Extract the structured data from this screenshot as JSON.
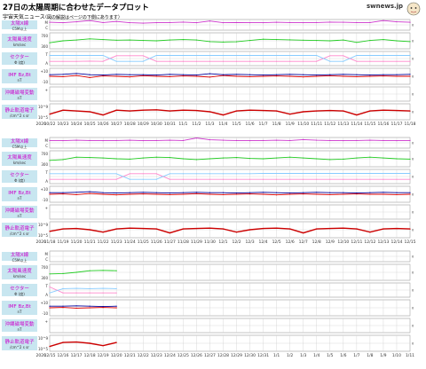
{
  "header": {
    "title": "27日の太陽周期に合わせたデータプロット",
    "subtitle": "宇宙天気ニュース",
    "note": "（図の解説はページの下側にあります）",
    "logo_text": "swnews.jp"
  },
  "colors": {
    "panel_bg": "#c8e6f0",
    "label_text": "#cc00cc",
    "grid": "#cfcfcf",
    "xray": "#cc33cc",
    "wind": "#22cc22",
    "sector_pink": "#ff88cc",
    "sector_blue": "#88ccff",
    "imf_bz": "#dd0000",
    "imf_bt": "#000099",
    "electron": "#cc0000"
  },
  "chart_data": [
    {
      "type": "line",
      "year_label": "2020",
      "x": [
        "10/22",
        "10/23",
        "10/24",
        "10/25",
        "10/26",
        "10/27",
        "10/28",
        "10/29",
        "10/30",
        "10/31",
        "11/1",
        "11/2",
        "11/3",
        "11/4",
        "11/5",
        "11/6",
        "11/7",
        "11/8",
        "11/9",
        "11/10",
        "11/11",
        "11/12",
        "11/13",
        "11/14",
        "11/15",
        "11/16",
        "11/17",
        "11/18"
      ],
      "panels": [
        {
          "label": "太陽X線",
          "sub": "C5M以上",
          "scale": [
            "M",
            "C"
          ],
          "series": [
            {
              "color_key": "xray",
              "values": [
                0.74,
                0.7,
                0.78,
                0.9,
                0.72,
                0.82,
                0.7,
                0.66,
                0.7,
                0.72,
                0.76,
                0.7,
                0.86,
                0.7,
                0.72,
                0.7,
                0.7,
                0.74,
                0.72,
                0.7,
                0.72,
                0.76,
                0.74,
                0.72,
                0.72,
                0.9,
                0.78,
                0.74
              ]
            }
          ]
        },
        {
          "label": "太陽風速度",
          "sub": "km/sec",
          "scale": [
            "700",
            "300"
          ],
          "series": [
            {
              "color_key": "wind",
              "values": [
                0.38,
                0.5,
                0.55,
                0.62,
                0.58,
                0.54,
                0.55,
                0.52,
                0.5,
                0.55,
                0.58,
                0.55,
                0.45,
                0.42,
                0.44,
                0.52,
                0.6,
                0.58,
                0.56,
                0.54,
                0.52,
                0.5,
                0.55,
                0.4,
                0.52,
                0.58,
                0.5,
                0.45
              ]
            }
          ]
        },
        {
          "label": "セクター",
          "sub": "Φ (度)",
          "scale": [
            "T",
            "A"
          ],
          "series": [
            {
              "color_key": "sector_pink",
              "values": [
                0.3,
                0.3,
                0.3,
                0.32,
                0.3,
                0.7,
                0.7,
                0.7,
                0.3,
                0.3,
                0.3,
                0.3,
                0.3,
                0.3,
                0.3,
                0.3,
                0.3,
                0.3,
                0.3,
                0.3,
                0.3,
                0.7,
                0.7,
                0.3,
                0.3,
                0.3,
                0.3,
                0.3
              ]
            },
            {
              "color_key": "sector_blue",
              "values": [
                0.72,
                0.72,
                0.72,
                0.72,
                0.72,
                0.3,
                0.3,
                0.3,
                0.72,
                0.72,
                0.72,
                0.72,
                0.72,
                0.72,
                0.72,
                0.72,
                0.72,
                0.72,
                0.72,
                0.72,
                0.72,
                0.3,
                0.3,
                0.72,
                0.72,
                0.72,
                0.72,
                0.72
              ]
            }
          ]
        },
        {
          "label": "IMF Bz,Bt",
          "sub": "nT",
          "scale": [
            "+10",
            "-10"
          ],
          "series": [
            {
              "color_key": "imf_bz",
              "values": [
                0.5,
                0.48,
                0.55,
                0.42,
                0.52,
                0.5,
                0.46,
                0.54,
                0.5,
                0.48,
                0.52,
                0.5,
                0.45,
                0.55,
                0.5,
                0.48,
                0.5,
                0.52,
                0.5,
                0.46,
                0.5,
                0.54,
                0.5,
                0.48,
                0.5,
                0.52,
                0.5,
                0.5
              ]
            },
            {
              "color_key": "imf_bt",
              "values": [
                0.6,
                0.62,
                0.68,
                0.6,
                0.58,
                0.62,
                0.6,
                0.6,
                0.58,
                0.62,
                0.6,
                0.58,
                0.66,
                0.6,
                0.62,
                0.6,
                0.58,
                0.6,
                0.62,
                0.6,
                0.58,
                0.6,
                0.62,
                0.6,
                0.58,
                0.6,
                0.6,
                0.62
              ]
            }
          ]
        },
        {
          "label": "沖縄磁場変動",
          "sub": "nT",
          "scale": [
            "+",
            ""
          ],
          "series": []
        },
        {
          "label": "静止軌道電子",
          "sub": "/cm^2 s sr",
          "scale": [
            "10^9",
            "10^5"
          ],
          "series": [
            {
              "color_key": "electron",
              "values": [
                0.35,
                0.6,
                0.55,
                0.5,
                0.3,
                0.6,
                0.55,
                0.6,
                0.62,
                0.55,
                0.6,
                0.58,
                0.5,
                0.3,
                0.55,
                0.6,
                0.58,
                0.55,
                0.35,
                0.5,
                0.55,
                0.58,
                0.55,
                0.3,
                0.55,
                0.6,
                0.58,
                0.55
              ]
            }
          ]
        }
      ]
    },
    {
      "type": "line",
      "year_label": "2020",
      "x": [
        "11/18",
        "11/19",
        "11/20",
        "11/21",
        "11/22",
        "11/23",
        "11/24",
        "11/25",
        "11/26",
        "11/27",
        "11/28",
        "11/29",
        "11/30",
        "12/1",
        "12/2",
        "12/3",
        "12/4",
        "12/5",
        "12/6",
        "12/7",
        "12/8",
        "12/9",
        "12/10",
        "12/11",
        "12/12",
        "12/13",
        "12/14",
        "12/15"
      ],
      "panels": [
        {
          "label": "太陽X線",
          "sub": "C5M以上",
          "scale": [
            "M",
            "C"
          ],
          "series": [
            {
              "color_key": "xray",
              "values": [
                0.72,
                0.7,
                0.74,
                0.72,
                0.7,
                0.72,
                0.74,
                0.7,
                0.72,
                0.74,
                0.72,
                0.95,
                0.78,
                0.74,
                0.72,
                0.7,
                0.72,
                0.74,
                0.72,
                0.8,
                0.74,
                0.72,
                0.7,
                0.72,
                0.74,
                0.72,
                0.7,
                0.72
              ]
            }
          ]
        },
        {
          "label": "太陽風速度",
          "sub": "km/sec",
          "scale": [
            "700",
            "300"
          ],
          "series": [
            {
              "color_key": "wind",
              "values": [
                0.4,
                0.45,
                0.6,
                0.58,
                0.55,
                0.5,
                0.48,
                0.55,
                0.6,
                0.58,
                0.5,
                0.45,
                0.5,
                0.55,
                0.58,
                0.52,
                0.5,
                0.55,
                0.6,
                0.55,
                0.5,
                0.45,
                0.48,
                0.55,
                0.6,
                0.55,
                0.5,
                0.48
              ]
            }
          ]
        },
        {
          "label": "セクター",
          "sub": "Φ (度)",
          "scale": [
            "T",
            "A"
          ],
          "series": [
            {
              "color_key": "sector_pink",
              "values": [
                0.3,
                0.3,
                0.3,
                0.3,
                0.3,
                0.3,
                0.7,
                0.7,
                0.7,
                0.3,
                0.3,
                0.3,
                0.3,
                0.3,
                0.3,
                0.3,
                0.3,
                0.3,
                0.3,
                0.3,
                0.3,
                0.3,
                0.3,
                0.3,
                0.3,
                0.3,
                0.3,
                0.3
              ]
            },
            {
              "color_key": "sector_blue",
              "values": [
                0.7,
                0.7,
                0.7,
                0.7,
                0.7,
                0.7,
                0.3,
                0.3,
                0.3,
                0.7,
                0.7,
                0.7,
                0.7,
                0.7,
                0.7,
                0.7,
                0.72,
                0.72,
                0.72,
                0.72,
                0.72,
                0.72,
                0.72,
                0.72,
                0.72,
                0.72,
                0.72,
                0.72
              ]
            }
          ]
        },
        {
          "label": "IMF Bz,Bt",
          "sub": "nT",
          "scale": [
            "+10",
            "-10"
          ],
          "series": [
            {
              "color_key": "imf_bz",
              "values": [
                0.5,
                0.52,
                0.48,
                0.55,
                0.5,
                0.46,
                0.5,
                0.52,
                0.5,
                0.48,
                0.5,
                0.54,
                0.5,
                0.48,
                0.5,
                0.52,
                0.5,
                0.46,
                0.5,
                0.52,
                0.5,
                0.48,
                0.5,
                0.52,
                0.5,
                0.5,
                0.48,
                0.5
              ]
            },
            {
              "color_key": "imf_bt",
              "values": [
                0.6,
                0.6,
                0.62,
                0.66,
                0.6,
                0.58,
                0.6,
                0.62,
                0.6,
                0.58,
                0.6,
                0.62,
                0.6,
                0.6,
                0.58,
                0.6,
                0.62,
                0.6,
                0.58,
                0.6,
                0.62,
                0.6,
                0.6,
                0.58,
                0.6,
                0.62,
                0.6,
                0.6
              ]
            }
          ]
        },
        {
          "label": "沖縄磁場変動",
          "sub": "nT",
          "scale": [
            "+",
            ""
          ],
          "series": []
        },
        {
          "label": "静止軌道電子",
          "sub": "/cm^2 s sr",
          "scale": [
            "10^9",
            "10^5"
          ],
          "series": [
            {
              "color_key": "electron",
              "values": [
                0.4,
                0.55,
                0.58,
                0.5,
                0.35,
                0.55,
                0.6,
                0.58,
                0.55,
                0.3,
                0.55,
                0.58,
                0.6,
                0.55,
                0.35,
                0.5,
                0.58,
                0.6,
                0.55,
                0.3,
                0.55,
                0.58,
                0.6,
                0.55,
                0.35,
                0.55,
                0.58,
                0.55
              ]
            }
          ]
        }
      ]
    },
    {
      "type": "line",
      "year_label": "2020",
      "x": [
        "12/15",
        "12/16",
        "12/17",
        "12/18",
        "12/19",
        "12/20",
        "12/21",
        "12/22",
        "12/23",
        "12/24",
        "12/25",
        "12/26",
        "12/27",
        "12/28",
        "12/29",
        "12/30",
        "12/31",
        "1/1",
        "1/2",
        "1/3",
        "1/4",
        "1/5",
        "1/6",
        "1/7",
        "1/8",
        "1/9",
        "1/10",
        "1/11"
      ],
      "panels": [
        {
          "label": "太陽X線",
          "sub": "C5M以上",
          "scale": [
            "M",
            "C"
          ],
          "series": []
        },
        {
          "label": "太陽風速度",
          "sub": "km/sec",
          "scale": [
            "700",
            "300"
          ],
          "series": [
            {
              "color_key": "wind",
              "values": [
                0.4,
                0.42,
                0.5,
                0.6,
                0.62,
                0.6
              ]
            }
          ]
        },
        {
          "label": "セクター",
          "sub": "Φ (度)",
          "scale": [
            "T",
            "A"
          ],
          "series": [
            {
              "color_key": "sector_pink",
              "values": [
                0.72,
                0.3,
                0.3,
                0.3,
                0.3,
                0.3
              ]
            },
            {
              "color_key": "sector_blue",
              "values": [
                0.3,
                0.6,
                0.62,
                0.6,
                0.62,
                0.6
              ]
            }
          ]
        },
        {
          "label": "IMF Bz,Bt",
          "sub": "nT",
          "scale": [
            "+10",
            "-10"
          ],
          "series": [
            {
              "color_key": "imf_bz",
              "values": [
                0.5,
                0.52,
                0.48,
                0.5,
                0.52,
                0.5
              ]
            },
            {
              "color_key": "imf_bt",
              "values": [
                0.6,
                0.6,
                0.62,
                0.6,
                0.58,
                0.6
              ]
            }
          ]
        },
        {
          "label": "沖縄磁場変動",
          "sub": "nT",
          "scale": [
            "+",
            ""
          ],
          "series": []
        },
        {
          "label": "静止軌道電子",
          "sub": "/cm^2 s sr",
          "scale": [
            "10^9",
            "10^5"
          ],
          "series": [
            {
              "color_key": "electron",
              "values": [
                0.3,
                0.55,
                0.58,
                0.5,
                0.35,
                0.55
              ]
            }
          ]
        }
      ]
    }
  ]
}
